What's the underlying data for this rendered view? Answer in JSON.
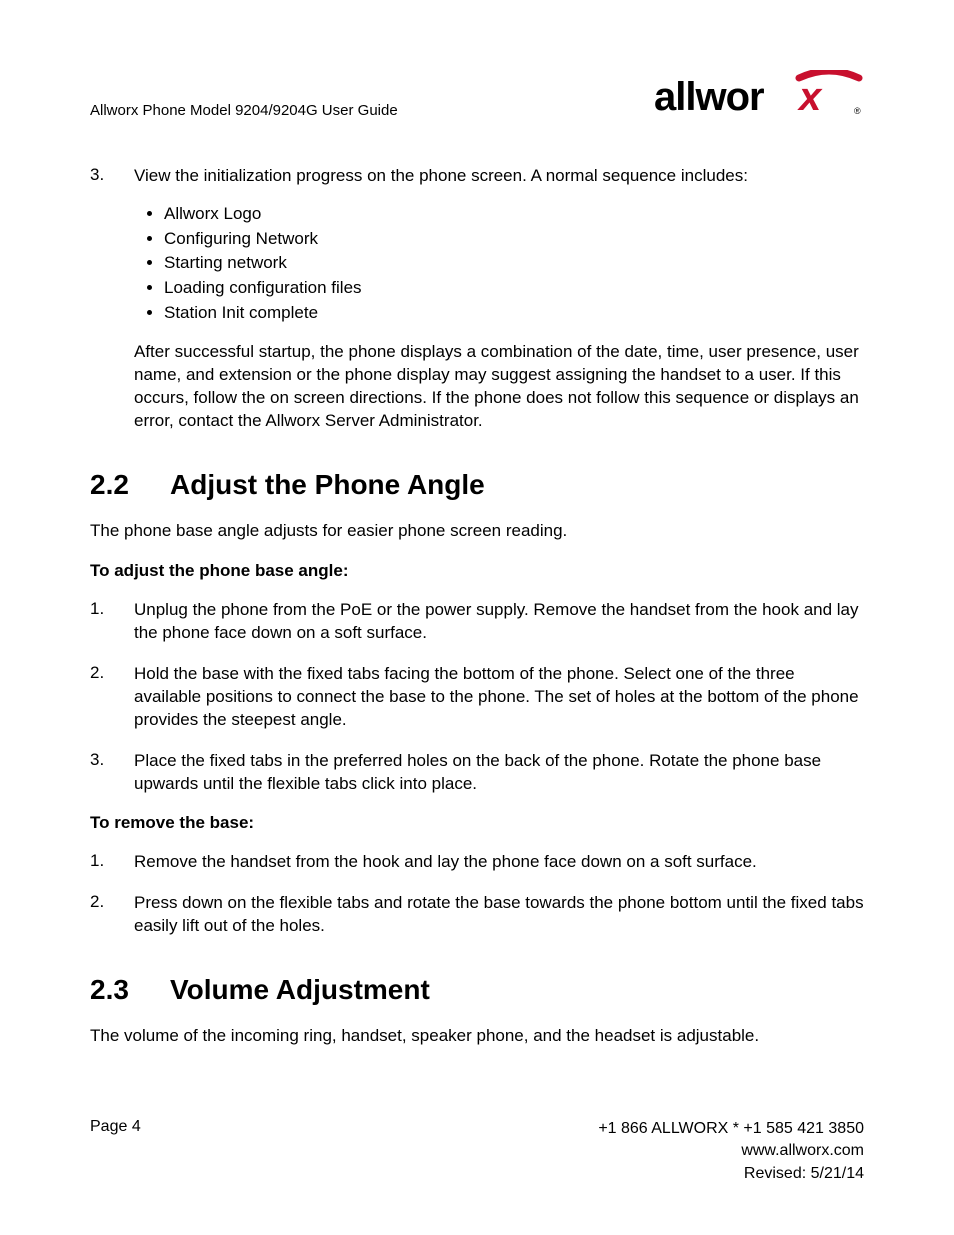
{
  "header": {
    "title": "Allworx Phone Model 9204/9204G User Guide",
    "logo_text": "allworx",
    "logo_reg": "®"
  },
  "step3": {
    "marker": "3.",
    "lead": "View the initialization progress on the phone screen. A normal sequence includes:",
    "bullets": [
      "Allworx Logo",
      "Configuring Network",
      "Starting network",
      "Loading configuration files",
      "Station Init complete"
    ],
    "after": "After successful startup, the phone displays a combination of the date, time, user presence, user name, and extension or the phone display may suggest assigning the handset to a user. If this occurs, follow the on screen directions. If the phone does not follow this sequence or displays an error, contact the Allworx Server Administrator."
  },
  "section22": {
    "num": "2.2",
    "title": "Adjust the Phone Angle",
    "intro": "The phone base angle adjusts for easier phone screen reading.",
    "sub1": "To adjust the phone base angle:",
    "steps1": [
      {
        "marker": "1.",
        "text": "Unplug the phone from the PoE or the power supply. Remove the handset from the hook and lay the phone face down on a soft surface."
      },
      {
        "marker": "2.",
        "text": "Hold the base with the fixed tabs facing the bottom of the phone. Select one of the three available positions to connect the base to the phone. The set of holes at the bottom of the phone provides the steepest angle."
      },
      {
        "marker": "3.",
        "text": "Place the fixed tabs in the preferred holes on the back of the phone. Rotate the phone base upwards until the flexible tabs click into place."
      }
    ],
    "sub2": "To remove the base:",
    "steps2": [
      {
        "marker": "1.",
        "text": "Remove the handset from the hook and lay the phone face down on a soft surface."
      },
      {
        "marker": "2.",
        "text": "Press down on the flexible tabs and rotate the base towards the phone bottom until the fixed tabs easily lift out of the holes."
      }
    ]
  },
  "section23": {
    "num": "2.3",
    "title": "Volume Adjustment",
    "intro": "The volume of the incoming ring, handset, speaker phone, and the headset is adjustable."
  },
  "footer": {
    "page": "Page 4",
    "phone": "+1 866 ALLWORX * +1 585 421 3850",
    "url": "www.allworx.com",
    "revised": "Revised: 5/21/14"
  }
}
